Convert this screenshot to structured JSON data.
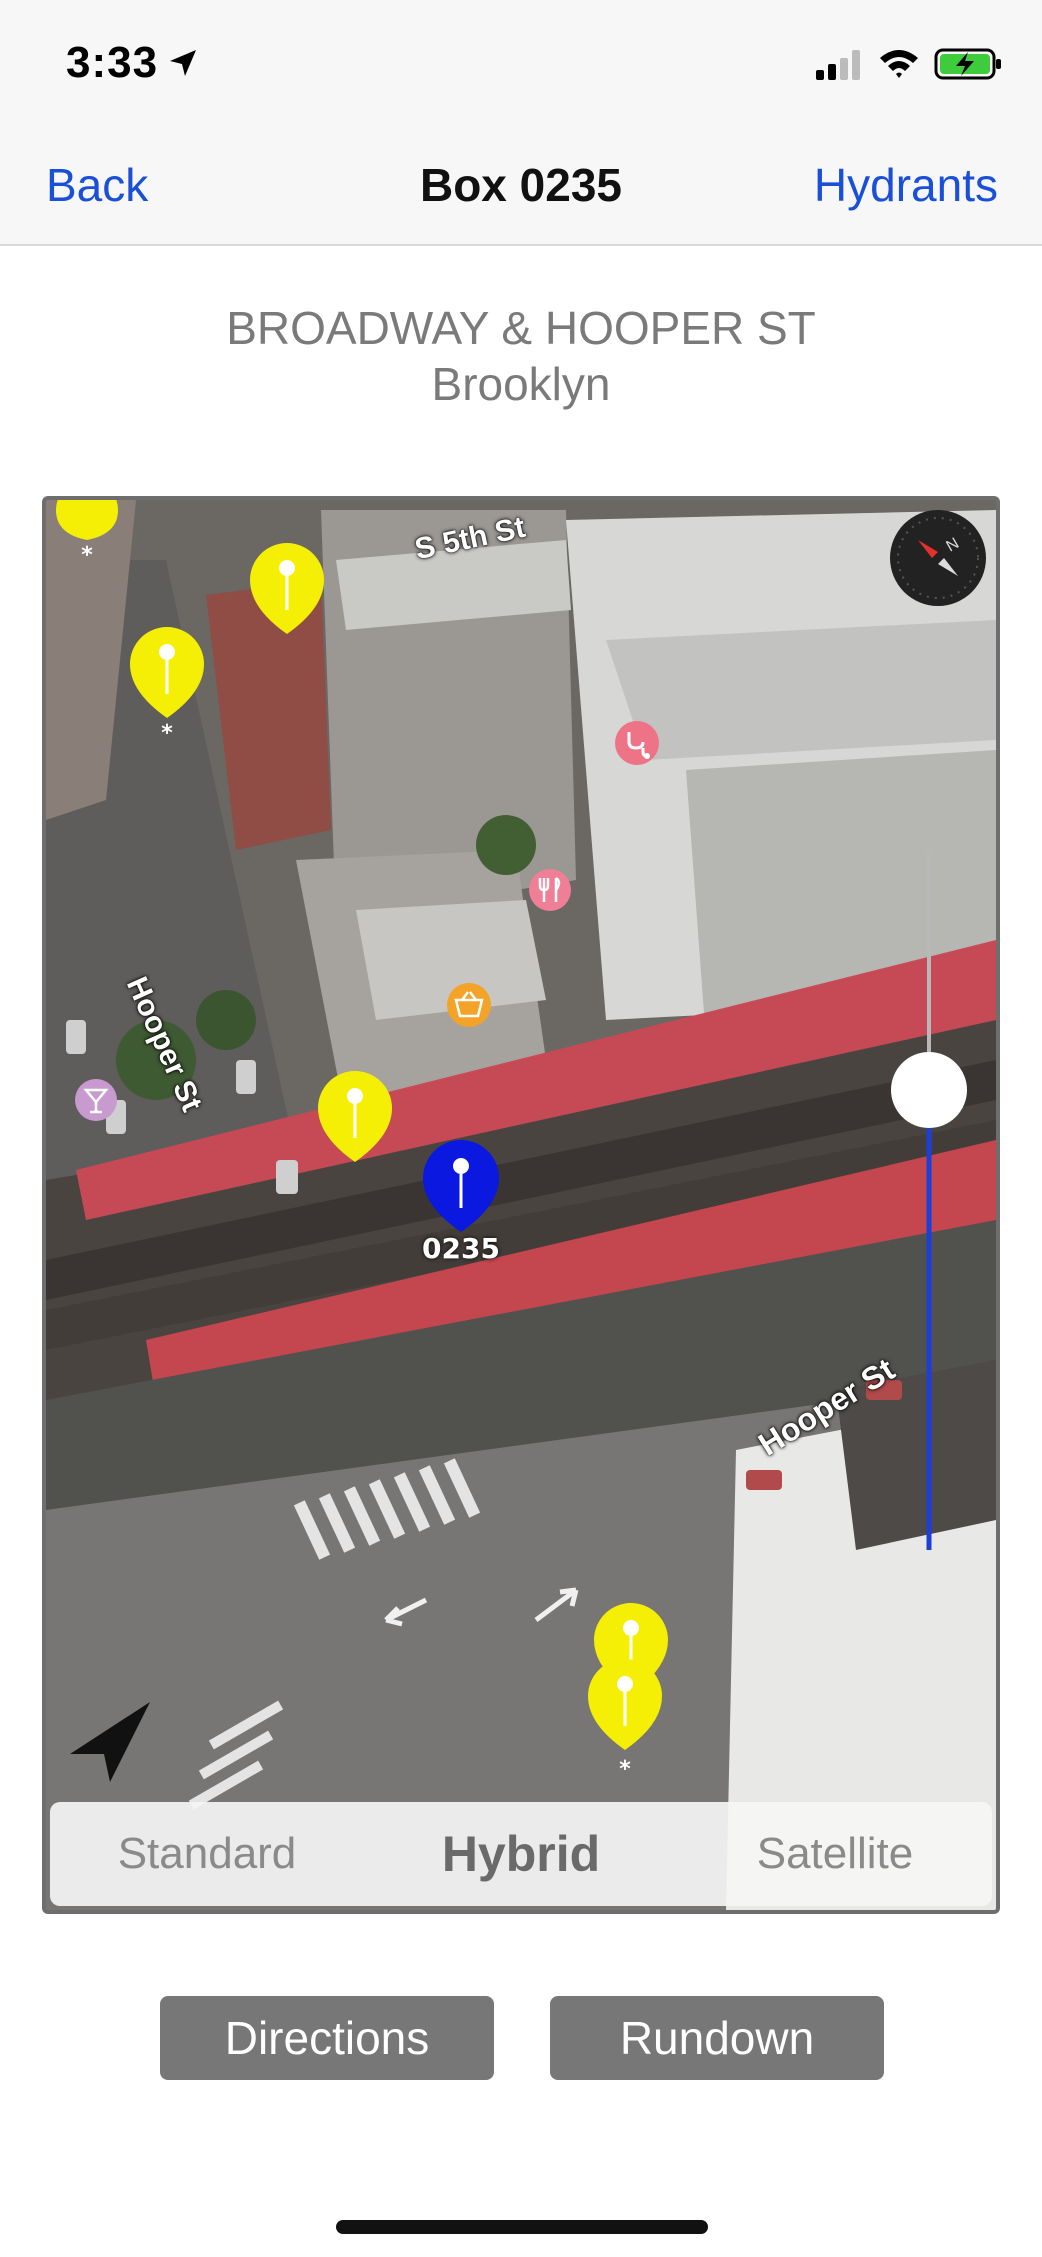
{
  "status": {
    "time": "3:33"
  },
  "nav": {
    "back_label": "Back",
    "title": "Box 0235",
    "right_label": "Hydrants"
  },
  "address": {
    "street": "BROADWAY & HOOPER ST",
    "borough": "Brooklyn"
  },
  "map": {
    "street_labels": {
      "s5th": "S 5th St",
      "hooper_left": "Hooper St",
      "hooper_right": "Hooper St"
    },
    "box_pin_label": "0235",
    "colors": {
      "hydrant_pin": "#f5ef05",
      "box_pin": "#0a18e0",
      "roof": "#c64a56"
    }
  },
  "map_types": {
    "options": [
      "Standard",
      "Hybrid",
      "Satellite"
    ],
    "selected": "Hybrid"
  },
  "actions": {
    "directions_label": "Directions",
    "rundown_label": "Rundown"
  }
}
